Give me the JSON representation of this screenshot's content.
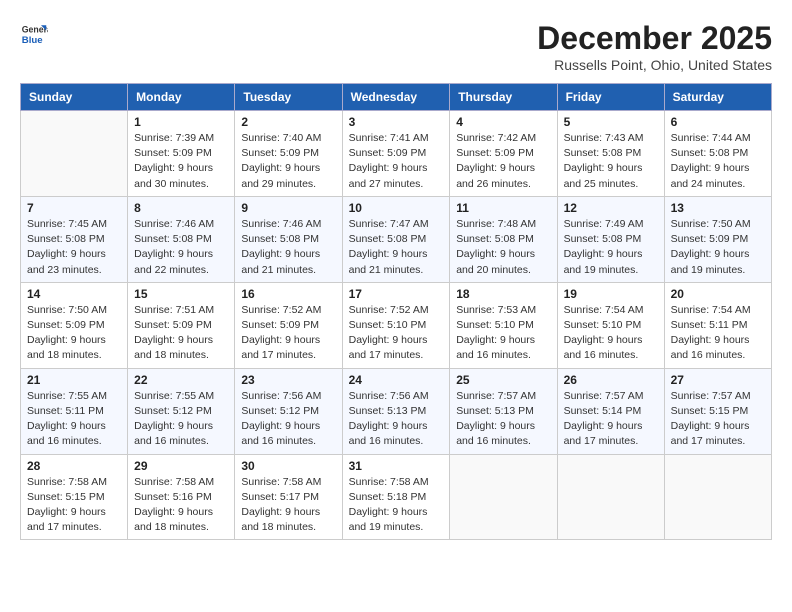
{
  "logo": {
    "general": "General",
    "blue": "Blue"
  },
  "header": {
    "month": "December 2025",
    "location": "Russells Point, Ohio, United States"
  },
  "weekdays": [
    "Sunday",
    "Monday",
    "Tuesday",
    "Wednesday",
    "Thursday",
    "Friday",
    "Saturday"
  ],
  "weeks": [
    [
      {
        "day": "",
        "info": ""
      },
      {
        "day": "1",
        "info": "Sunrise: 7:39 AM\nSunset: 5:09 PM\nDaylight: 9 hours\nand 30 minutes."
      },
      {
        "day": "2",
        "info": "Sunrise: 7:40 AM\nSunset: 5:09 PM\nDaylight: 9 hours\nand 29 minutes."
      },
      {
        "day": "3",
        "info": "Sunrise: 7:41 AM\nSunset: 5:09 PM\nDaylight: 9 hours\nand 27 minutes."
      },
      {
        "day": "4",
        "info": "Sunrise: 7:42 AM\nSunset: 5:09 PM\nDaylight: 9 hours\nand 26 minutes."
      },
      {
        "day": "5",
        "info": "Sunrise: 7:43 AM\nSunset: 5:08 PM\nDaylight: 9 hours\nand 25 minutes."
      },
      {
        "day": "6",
        "info": "Sunrise: 7:44 AM\nSunset: 5:08 PM\nDaylight: 9 hours\nand 24 minutes."
      }
    ],
    [
      {
        "day": "7",
        "info": "Sunrise: 7:45 AM\nSunset: 5:08 PM\nDaylight: 9 hours\nand 23 minutes."
      },
      {
        "day": "8",
        "info": "Sunrise: 7:46 AM\nSunset: 5:08 PM\nDaylight: 9 hours\nand 22 minutes."
      },
      {
        "day": "9",
        "info": "Sunrise: 7:46 AM\nSunset: 5:08 PM\nDaylight: 9 hours\nand 21 minutes."
      },
      {
        "day": "10",
        "info": "Sunrise: 7:47 AM\nSunset: 5:08 PM\nDaylight: 9 hours\nand 21 minutes."
      },
      {
        "day": "11",
        "info": "Sunrise: 7:48 AM\nSunset: 5:08 PM\nDaylight: 9 hours\nand 20 minutes."
      },
      {
        "day": "12",
        "info": "Sunrise: 7:49 AM\nSunset: 5:08 PM\nDaylight: 9 hours\nand 19 minutes."
      },
      {
        "day": "13",
        "info": "Sunrise: 7:50 AM\nSunset: 5:09 PM\nDaylight: 9 hours\nand 19 minutes."
      }
    ],
    [
      {
        "day": "14",
        "info": "Sunrise: 7:50 AM\nSunset: 5:09 PM\nDaylight: 9 hours\nand 18 minutes."
      },
      {
        "day": "15",
        "info": "Sunrise: 7:51 AM\nSunset: 5:09 PM\nDaylight: 9 hours\nand 18 minutes."
      },
      {
        "day": "16",
        "info": "Sunrise: 7:52 AM\nSunset: 5:09 PM\nDaylight: 9 hours\nand 17 minutes."
      },
      {
        "day": "17",
        "info": "Sunrise: 7:52 AM\nSunset: 5:10 PM\nDaylight: 9 hours\nand 17 minutes."
      },
      {
        "day": "18",
        "info": "Sunrise: 7:53 AM\nSunset: 5:10 PM\nDaylight: 9 hours\nand 16 minutes."
      },
      {
        "day": "19",
        "info": "Sunrise: 7:54 AM\nSunset: 5:10 PM\nDaylight: 9 hours\nand 16 minutes."
      },
      {
        "day": "20",
        "info": "Sunrise: 7:54 AM\nSunset: 5:11 PM\nDaylight: 9 hours\nand 16 minutes."
      }
    ],
    [
      {
        "day": "21",
        "info": "Sunrise: 7:55 AM\nSunset: 5:11 PM\nDaylight: 9 hours\nand 16 minutes."
      },
      {
        "day": "22",
        "info": "Sunrise: 7:55 AM\nSunset: 5:12 PM\nDaylight: 9 hours\nand 16 minutes."
      },
      {
        "day": "23",
        "info": "Sunrise: 7:56 AM\nSunset: 5:12 PM\nDaylight: 9 hours\nand 16 minutes."
      },
      {
        "day": "24",
        "info": "Sunrise: 7:56 AM\nSunset: 5:13 PM\nDaylight: 9 hours\nand 16 minutes."
      },
      {
        "day": "25",
        "info": "Sunrise: 7:57 AM\nSunset: 5:13 PM\nDaylight: 9 hours\nand 16 minutes."
      },
      {
        "day": "26",
        "info": "Sunrise: 7:57 AM\nSunset: 5:14 PM\nDaylight: 9 hours\nand 17 minutes."
      },
      {
        "day": "27",
        "info": "Sunrise: 7:57 AM\nSunset: 5:15 PM\nDaylight: 9 hours\nand 17 minutes."
      }
    ],
    [
      {
        "day": "28",
        "info": "Sunrise: 7:58 AM\nSunset: 5:15 PM\nDaylight: 9 hours\nand 17 minutes."
      },
      {
        "day": "29",
        "info": "Sunrise: 7:58 AM\nSunset: 5:16 PM\nDaylight: 9 hours\nand 18 minutes."
      },
      {
        "day": "30",
        "info": "Sunrise: 7:58 AM\nSunset: 5:17 PM\nDaylight: 9 hours\nand 18 minutes."
      },
      {
        "day": "31",
        "info": "Sunrise: 7:58 AM\nSunset: 5:18 PM\nDaylight: 9 hours\nand 19 minutes."
      },
      {
        "day": "",
        "info": ""
      },
      {
        "day": "",
        "info": ""
      },
      {
        "day": "",
        "info": ""
      }
    ]
  ]
}
